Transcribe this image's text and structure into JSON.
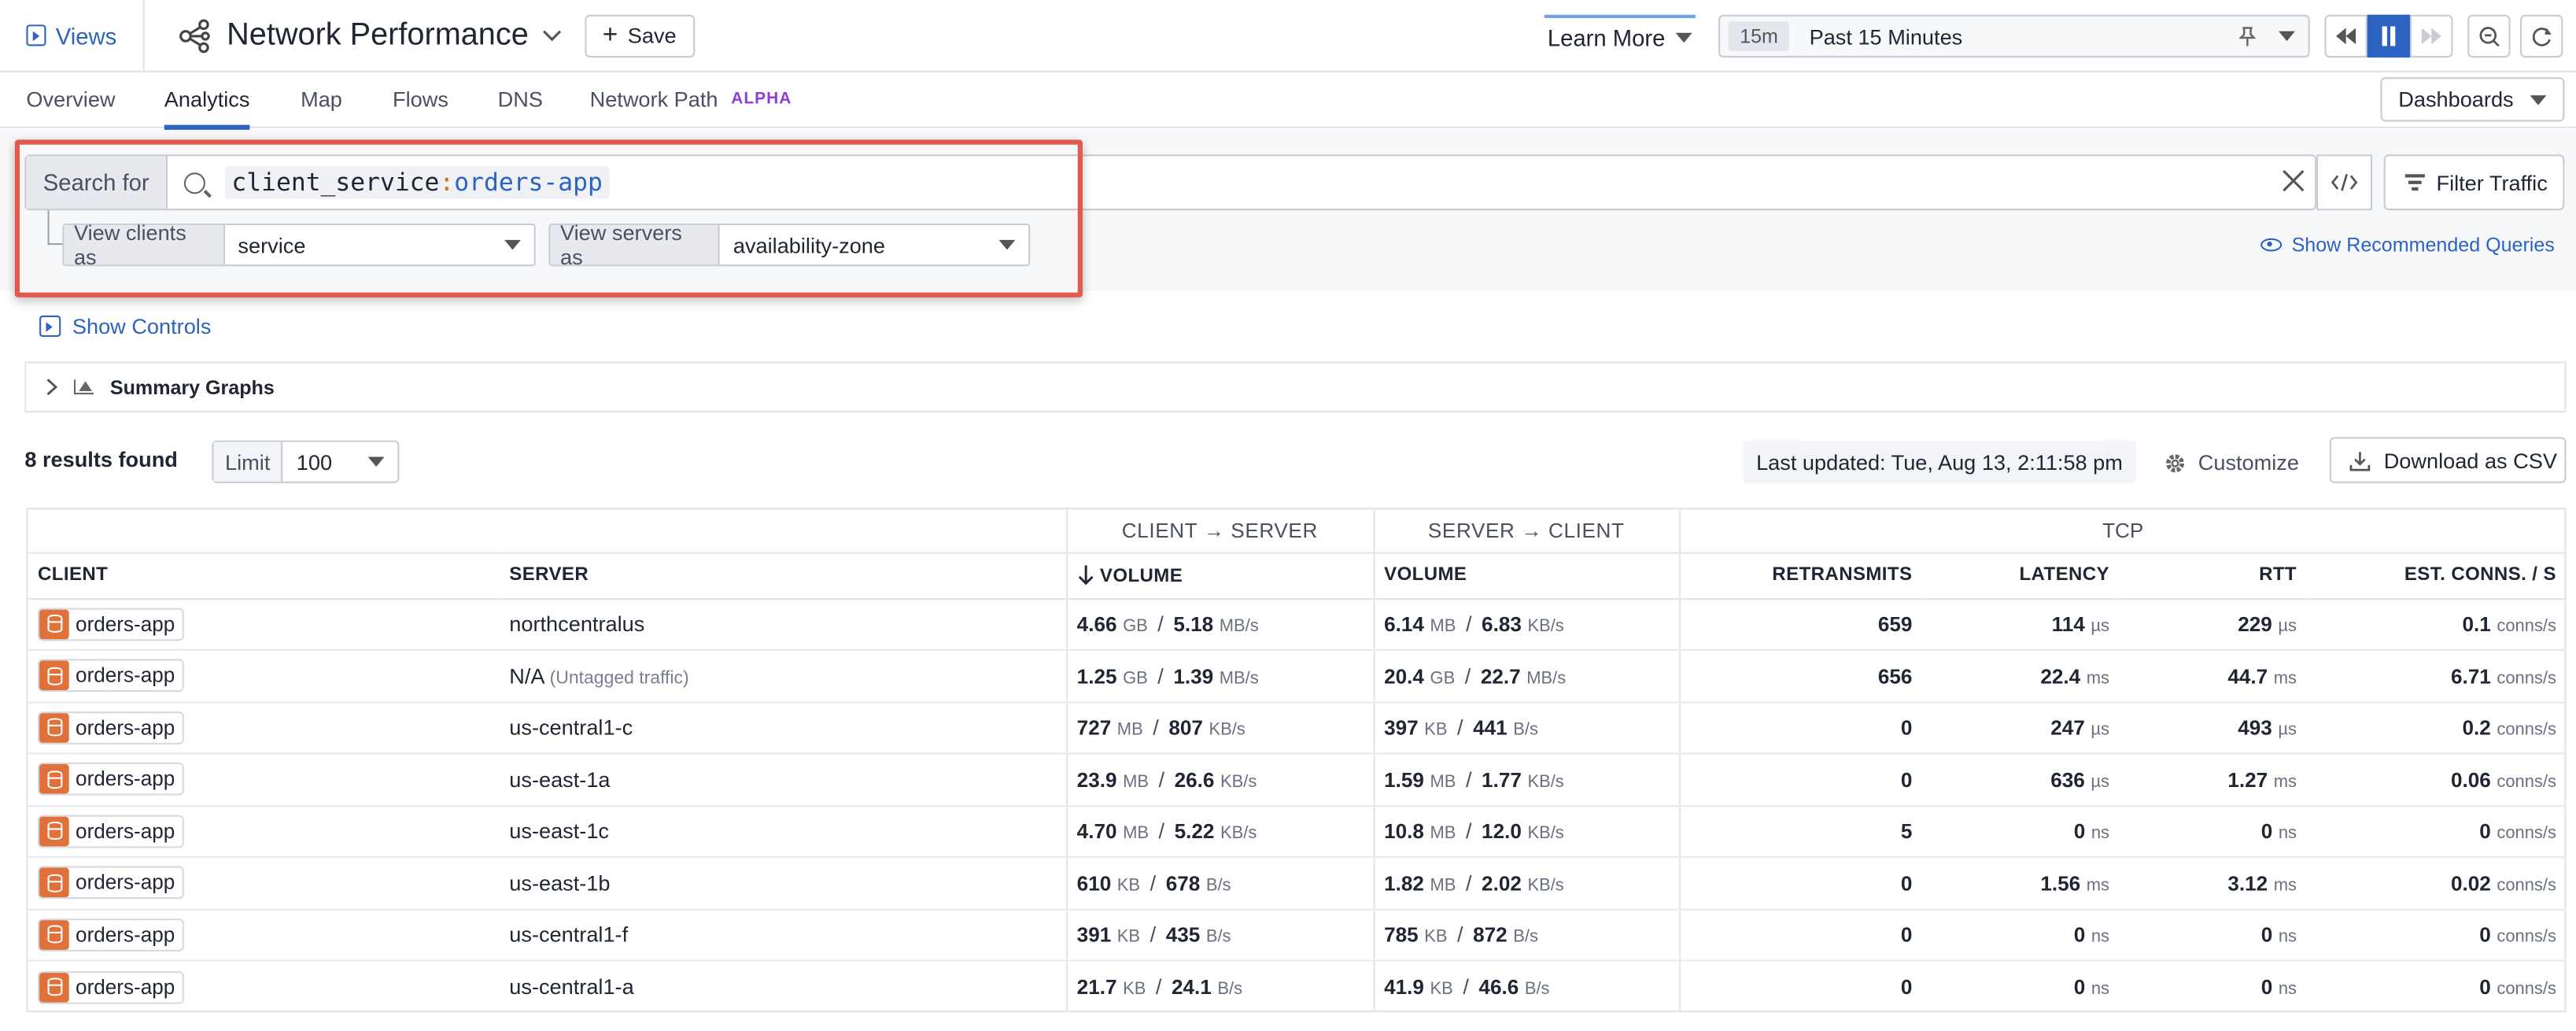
{
  "topbar": {
    "views_label": "Views",
    "title": "Network Performance",
    "save_label": "Save",
    "learn_more": "Learn More",
    "time_chip": "15m",
    "time_label": "Past 15 Minutes"
  },
  "tabs": [
    {
      "label": "Overview"
    },
    {
      "label": "Analytics"
    },
    {
      "label": "Map"
    },
    {
      "label": "Flows"
    },
    {
      "label": "DNS"
    },
    {
      "label": "Network Path",
      "badge": "ALPHA"
    }
  ],
  "dashboards_label": "Dashboards",
  "search": {
    "prefix": "Search for",
    "query_key": "client_service",
    "query_colon": ":",
    "query_value": "orders-app",
    "filter_label": "Filter Traffic",
    "view_clients_label": "View clients as",
    "view_clients_value": "service",
    "view_servers_label": "View servers as",
    "view_servers_value": "availability-zone",
    "recommended": "Show Recommended Queries"
  },
  "show_controls": "Show Controls",
  "summary_graphs": "Summary Graphs",
  "results": {
    "count": "8 results found",
    "limit_label": "Limit",
    "limit_value": "100",
    "last_updated": "Last updated: Tue, Aug 13, 2:11:58 pm",
    "customize": "Customize",
    "download": "Download as CSV"
  },
  "table": {
    "groups": {
      "client_server": "CLIENT → SERVER",
      "server_client": "SERVER → CLIENT",
      "tcp": "TCP"
    },
    "headers": {
      "client": "CLIENT",
      "server": "SERVER",
      "volume_cs": "VOLUME",
      "volume_sc": "VOLUME",
      "retransmits": "RETRANSMITS",
      "latency": "LATENCY",
      "rtt": "RTT",
      "est_conns": "EST. CONNS. / S"
    },
    "rows": [
      {
        "client": "orders-app",
        "server": "northcentralus",
        "server_note": "",
        "cs_v": "4.66",
        "cs_vu": "GB",
        "cs_r": "5.18",
        "cs_ru": "MB/s",
        "sc_v": "6.14",
        "sc_vu": "MB",
        "sc_r": "6.83",
        "sc_ru": "KB/s",
        "retrans": "659",
        "lat": "114",
        "lat_u": "µs",
        "rtt": "229",
        "rtt_u": "µs",
        "conns": "0.1",
        "conns_u": "conns/s"
      },
      {
        "client": "orders-app",
        "server": "N/A",
        "server_note": "(Untagged traffic)",
        "cs_v": "1.25",
        "cs_vu": "GB",
        "cs_r": "1.39",
        "cs_ru": "MB/s",
        "sc_v": "20.4",
        "sc_vu": "GB",
        "sc_r": "22.7",
        "sc_ru": "MB/s",
        "retrans": "656",
        "lat": "22.4",
        "lat_u": "ms",
        "rtt": "44.7",
        "rtt_u": "ms",
        "conns": "6.71",
        "conns_u": "conns/s"
      },
      {
        "client": "orders-app",
        "server": "us-central1-c",
        "server_note": "",
        "cs_v": "727",
        "cs_vu": "MB",
        "cs_r": "807",
        "cs_ru": "KB/s",
        "sc_v": "397",
        "sc_vu": "KB",
        "sc_r": "441",
        "sc_ru": "B/s",
        "retrans": "0",
        "lat": "247",
        "lat_u": "µs",
        "rtt": "493",
        "rtt_u": "µs",
        "conns": "0.2",
        "conns_u": "conns/s"
      },
      {
        "client": "orders-app",
        "server": "us-east-1a",
        "server_note": "",
        "cs_v": "23.9",
        "cs_vu": "MB",
        "cs_r": "26.6",
        "cs_ru": "KB/s",
        "sc_v": "1.59",
        "sc_vu": "MB",
        "sc_r": "1.77",
        "sc_ru": "KB/s",
        "retrans": "0",
        "lat": "636",
        "lat_u": "µs",
        "rtt": "1.27",
        "rtt_u": "ms",
        "conns": "0.06",
        "conns_u": "conns/s"
      },
      {
        "client": "orders-app",
        "server": "us-east-1c",
        "server_note": "",
        "cs_v": "4.70",
        "cs_vu": "MB",
        "cs_r": "5.22",
        "cs_ru": "KB/s",
        "sc_v": "10.8",
        "sc_vu": "MB",
        "sc_r": "12.0",
        "sc_ru": "KB/s",
        "retrans": "5",
        "lat": "0",
        "lat_u": "ns",
        "rtt": "0",
        "rtt_u": "ns",
        "conns": "0",
        "conns_u": "conns/s"
      },
      {
        "client": "orders-app",
        "server": "us-east-1b",
        "server_note": "",
        "cs_v": "610",
        "cs_vu": "KB",
        "cs_r": "678",
        "cs_ru": "B/s",
        "sc_v": "1.82",
        "sc_vu": "MB",
        "sc_r": "2.02",
        "sc_ru": "KB/s",
        "retrans": "0",
        "lat": "1.56",
        "lat_u": "ms",
        "rtt": "3.12",
        "rtt_u": "ms",
        "conns": "0.02",
        "conns_u": "conns/s"
      },
      {
        "client": "orders-app",
        "server": "us-central1-f",
        "server_note": "",
        "cs_v": "391",
        "cs_vu": "KB",
        "cs_r": "435",
        "cs_ru": "B/s",
        "sc_v": "785",
        "sc_vu": "KB",
        "sc_r": "872",
        "sc_ru": "B/s",
        "retrans": "0",
        "lat": "0",
        "lat_u": "ns",
        "rtt": "0",
        "rtt_u": "ns",
        "conns": "0",
        "conns_u": "conns/s"
      },
      {
        "client": "orders-app",
        "server": "us-central1-a",
        "server_note": "",
        "cs_v": "21.7",
        "cs_vu": "KB",
        "cs_r": "24.1",
        "cs_ru": "B/s",
        "sc_v": "41.9",
        "sc_vu": "KB",
        "sc_r": "46.6",
        "sc_ru": "B/s",
        "retrans": "0",
        "lat": "0",
        "lat_u": "ns",
        "rtt": "0",
        "rtt_u": "ns",
        "conns": "0",
        "conns_u": "conns/s"
      }
    ]
  },
  "colors": {
    "accent": "#2c62c2",
    "highlight": "#e05a4f",
    "service_icon": "#e0713a",
    "alpha_badge": "#8c3fd6"
  }
}
